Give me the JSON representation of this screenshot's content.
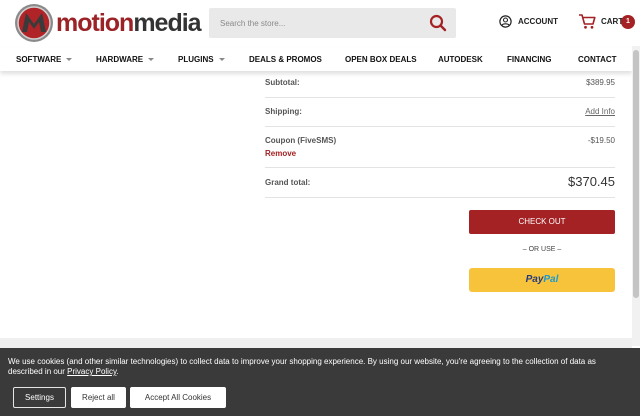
{
  "header": {
    "logo": {
      "part1": "motion",
      "part2": "media"
    },
    "search": {
      "placeholder": "Search the store..."
    },
    "account_label": "ACCOUNT",
    "cart_label": "CART",
    "cart_count": "1"
  },
  "nav": {
    "items": [
      {
        "label": "SOFTWARE",
        "has_dropdown": true
      },
      {
        "label": "HARDWARE",
        "has_dropdown": true
      },
      {
        "label": "PLUGINS",
        "has_dropdown": true
      },
      {
        "label": "DEALS & PROMOS",
        "has_dropdown": false
      },
      {
        "label": "OPEN BOX DEALS",
        "has_dropdown": false
      },
      {
        "label": "AUTODESK",
        "has_dropdown": false
      },
      {
        "label": "FINANCING",
        "has_dropdown": false
      },
      {
        "label": "CONTACT",
        "has_dropdown": false
      }
    ]
  },
  "summary": {
    "subtotal_label": "Subtotal:",
    "subtotal_value": "$389.95",
    "shipping_label": "Shipping:",
    "shipping_value": "Add Info",
    "coupon_label": "Coupon (FiveSMS)",
    "coupon_value": "-$19.50",
    "remove_label": "Remove",
    "grand_total_label": "Grand total:",
    "grand_total_value": "$370.45",
    "checkout_label": "CHECK OUT",
    "or_use_label": "– OR USE –",
    "paypal_part1": "Pay",
    "paypal_part2": "Pal"
  },
  "cookie_banner": {
    "text": "We use cookies (and other similar technologies) to collect data to improve your shopping experience. By using our website, you're agreeing to the collection of data as described in our",
    "link_text": "Privacy Policy",
    "text_end": ".",
    "settings_label": "Settings",
    "reject_label": "Reject all",
    "accept_label": "Accept All Cookies"
  },
  "colors": {
    "brand_red": "#a42124",
    "paypal_yellow": "#f7c33a",
    "banner_bg": "#3a3a3a"
  }
}
